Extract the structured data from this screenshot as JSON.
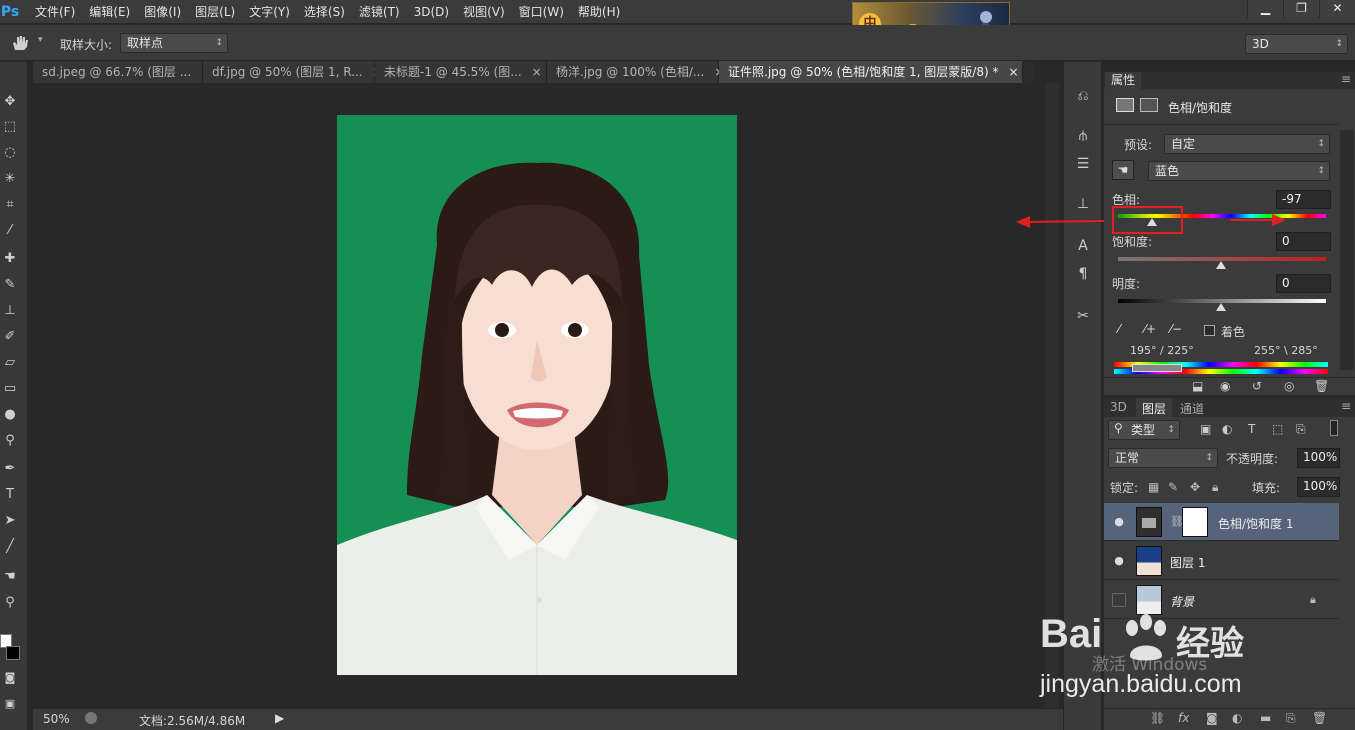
{
  "app": {
    "logo": "Ps"
  },
  "menu": [
    "文件(F)",
    "编辑(E)",
    "图像(I)",
    "图层(L)",
    "文字(Y)",
    "选择(S)",
    "滤镜(T)",
    "3D(D)",
    "视图(V)",
    "窗口(W)",
    "帮助(H)"
  ],
  "banner": {
    "char": "中"
  },
  "window_controls": [
    "▁",
    "❐",
    "✕"
  ],
  "options": {
    "sample_label": "取样大小:",
    "sample_value": "取样点",
    "workspace": "3D"
  },
  "tabs": [
    {
      "label": "sd.jpeg @ 66.7% (图层 ...",
      "close": "×"
    },
    {
      "label": "df.jpg @ 50% (图层 1, R...",
      "close": "×"
    },
    {
      "label": "未标题-1 @ 45.5% (图...",
      "close": "×"
    },
    {
      "label": "杨洋.jpg @ 100% (色相/...",
      "close": "×"
    },
    {
      "label": "证件照.jpg @ 50% (色相/饱和度 1, 图层蒙版/8) *",
      "close": "×"
    }
  ],
  "status": {
    "zoom": "50%",
    "doc": "文档:2.56M/4.86M"
  },
  "properties": {
    "tab": "属性",
    "title": "色相/饱和度",
    "preset_label": "预设:",
    "preset_value": "自定",
    "channel": "蓝色",
    "hue_label": "色相:",
    "hue_value": "-97",
    "sat_label": "饱和度:",
    "sat_value": "0",
    "light_label": "明度:",
    "light_value": "0",
    "colorize_label": "着色",
    "range_left": "195° / 225°",
    "range_right": "255° \\ 285°"
  },
  "layers_panel": {
    "tabs": [
      "3D",
      "图层",
      "通道"
    ],
    "filter": "类型",
    "blend": "正常",
    "opacity_label": "不透明度:",
    "opacity_value": "100%",
    "lock_label": "锁定:",
    "fill_label": "填充:",
    "fill_value": "100%",
    "layers": [
      {
        "name": "色相/饱和度 1",
        "selected": true
      },
      {
        "name": "图层 1",
        "selected": false
      },
      {
        "name": "背景",
        "selected": false
      }
    ]
  },
  "watermark": {
    "brand": "Bai",
    "brand2": "经验",
    "site": "jingyan.baidu.com",
    "activate": "激活 Windows"
  }
}
